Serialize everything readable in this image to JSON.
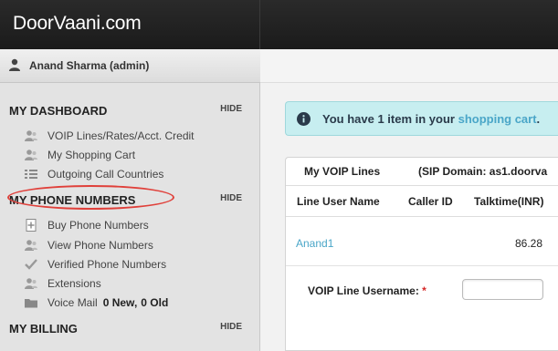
{
  "app": {
    "brand": "DoorVaani.com"
  },
  "user": {
    "name": "Anand Sharma (admin)"
  },
  "sidebar": {
    "hide_label": "HIDE",
    "sections": [
      {
        "title": "MY DASHBOARD",
        "items": [
          {
            "label": "VOIP Lines/Rates/Acct. Credit",
            "icon": "user-group-icon"
          },
          {
            "label": "My Shopping Cart",
            "icon": "user-group-icon"
          },
          {
            "label": "Outgoing Call Countries",
            "icon": "list-icon"
          }
        ]
      },
      {
        "title": "MY PHONE NUMBERS",
        "items": [
          {
            "label": "Buy Phone Numbers",
            "icon": "add-document-icon"
          },
          {
            "label": "View Phone Numbers",
            "icon": "user-group-icon",
            "highlighted": true
          },
          {
            "label": "Verified Phone Numbers",
            "icon": "checkmark-icon"
          },
          {
            "label": "Extensions",
            "icon": "user-group-icon"
          },
          {
            "label": "Voice Mail",
            "icon": "folder-icon",
            "new_count": "0 New,",
            "old_count": "0 Old"
          }
        ]
      },
      {
        "title": "MY BILLING",
        "items": []
      }
    ]
  },
  "alert": {
    "text": "You have 1 item in your",
    "link": "shopping cart",
    "suffix": "."
  },
  "voip_panel": {
    "title": "My VOIP Lines",
    "sip_domain": "(SIP Domain: as1.doorva",
    "columns": [
      "Line User Name",
      "Caller ID",
      "Talktime(INR)"
    ],
    "rows": [
      {
        "line_user_name": "Anand1",
        "caller_id": "",
        "talktime": "86.28"
      }
    ],
    "form": {
      "label": "VOIP Line Username:",
      "required_mark": "*",
      "value": ""
    }
  },
  "colors": {
    "link": "#4aa6c8",
    "highlight_ring": "#e0403a",
    "alert_bg": "#c7eef0"
  }
}
